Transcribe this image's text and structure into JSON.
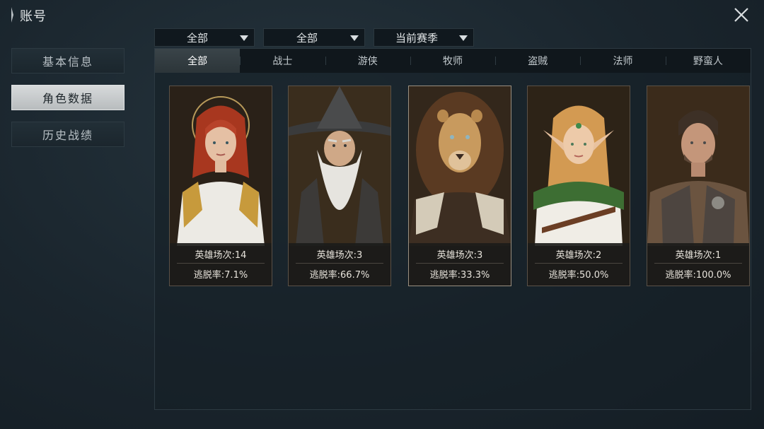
{
  "header": {
    "title": "账号"
  },
  "sidebar": {
    "items": [
      {
        "label": "基本信息",
        "active": false
      },
      {
        "label": "角色数据",
        "active": true
      },
      {
        "label": "历史战绩",
        "active": false
      }
    ]
  },
  "filters": [
    {
      "value": "全部"
    },
    {
      "value": "全部"
    },
    {
      "value": "当前赛季"
    }
  ],
  "tabs": [
    {
      "label": "全部",
      "active": true
    },
    {
      "label": "战士",
      "active": false
    },
    {
      "label": "游侠",
      "active": false
    },
    {
      "label": "牧师",
      "active": false
    },
    {
      "label": "盗贼",
      "active": false
    },
    {
      "label": "法师",
      "active": false
    },
    {
      "label": "野蛮人",
      "active": false
    }
  ],
  "characters": [
    {
      "portrait": "red-haired-woman-portrait",
      "matches": "英雄场次:14",
      "escape_rate": "逃脱率:7.1%"
    },
    {
      "portrait": "bearded-wizard-portrait",
      "matches": "英雄场次:3",
      "escape_rate": "逃脱率:66.7%"
    },
    {
      "portrait": "lion-warrior-portrait",
      "matches": "英雄场次:3",
      "escape_rate": "逃脱率:33.3%"
    },
    {
      "portrait": "elf-woman-portrait",
      "matches": "英雄场次:2",
      "escape_rate": "逃脱率:50.0%"
    },
    {
      "portrait": "rugged-man-portrait",
      "matches": "英雄场次:1",
      "escape_rate": "逃脱率:100.0%"
    }
  ],
  "colors": {
    "accent": "#c9b07a",
    "panel": "#1b262d",
    "active_nav": "#c8cbcc"
  }
}
